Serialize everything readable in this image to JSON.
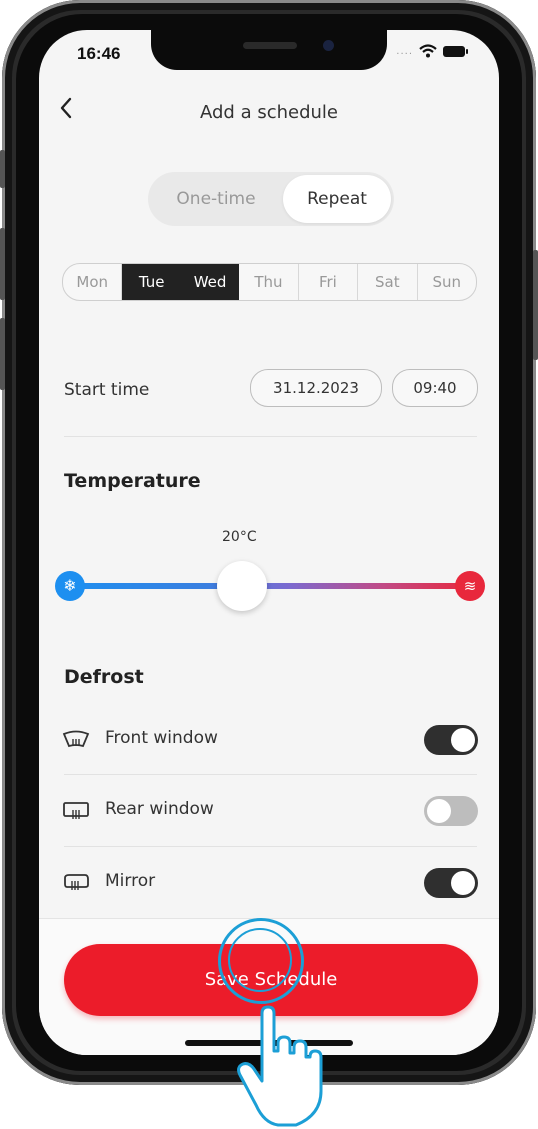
{
  "status_bar": {
    "time": "16:46",
    "signal": "....",
    "wifi_icon": "wifi-icon",
    "battery_icon": "battery-icon"
  },
  "header": {
    "back_icon": "chevron-left-icon",
    "title": "Add a schedule"
  },
  "mode": {
    "options": [
      "One-time",
      "Repeat"
    ],
    "selected": "Repeat"
  },
  "days": {
    "items": [
      {
        "label": "Mon",
        "selected": false
      },
      {
        "label": "Tue",
        "selected": true
      },
      {
        "label": "Wed",
        "selected": true
      },
      {
        "label": "Thu",
        "selected": false
      },
      {
        "label": "Fri",
        "selected": false
      },
      {
        "label": "Sat",
        "selected": false
      },
      {
        "label": "Sun",
        "selected": false
      }
    ]
  },
  "start_time": {
    "label": "Start time",
    "date": "31.12.2023",
    "time": "09:40"
  },
  "temperature": {
    "heading": "Temperature",
    "value": "20°C",
    "cold_icon": "snowflake-icon",
    "hot_icon": "heat-waves-icon",
    "level": 0.45,
    "colors": {
      "cold": "#1d8ff0",
      "hot": "#e8283c"
    }
  },
  "defrost": {
    "heading": "Defrost",
    "items": [
      {
        "label": "Front window",
        "icon": "front-window-defrost-icon",
        "on": true
      },
      {
        "label": "Rear window",
        "icon": "rear-window-defrost-icon",
        "on": false
      },
      {
        "label": "Mirror",
        "icon": "mirror-defrost-icon",
        "on": true
      }
    ]
  },
  "save_button": {
    "label": "Save Schedule",
    "color": "#ec1c2a"
  },
  "overlay": {
    "pointer_icon": "tap-hand-icon"
  }
}
